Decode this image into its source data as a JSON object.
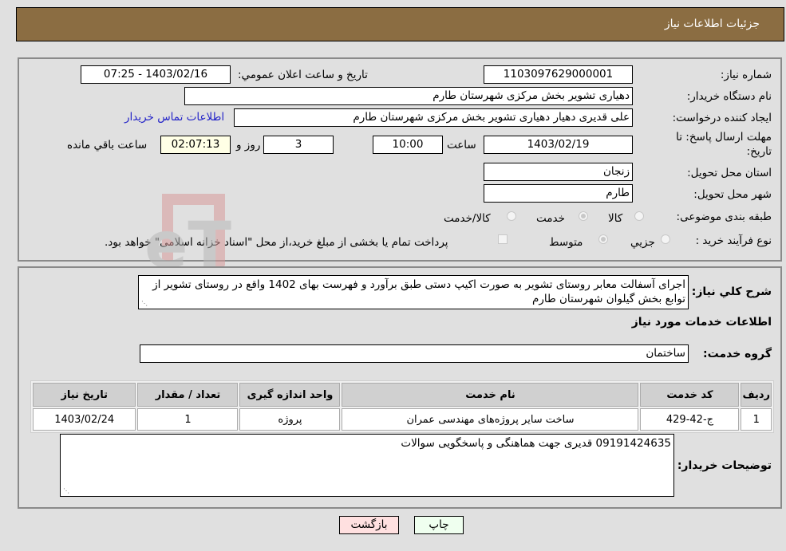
{
  "header": {
    "title": "جزئیات اطلاعات نیاز"
  },
  "form": {
    "need_number": {
      "label": "شماره نیاز:",
      "value": "1103097629000001"
    },
    "announce_datetime": {
      "label": "تاریخ و ساعت اعلان عمومي:",
      "value": "1403/02/16 - 07:25"
    },
    "buyer_org": {
      "label": "نام دستگاه خريدار:",
      "value": "دهیاری تشویر بخش مرکزی شهرستان طارم"
    },
    "requester": {
      "label": "ايجاد کننده درخواست:",
      "value": "علی قدیری دهیار دهیاری تشویر بخش مرکزی شهرستان طارم"
    },
    "buyer_contact_link": "اطلاعات تماس خريدار",
    "deadline": {
      "label_line1": "مهلت ارسال پاسخ: تا",
      "label_line2": "تاريخ:",
      "date": "1403/02/19",
      "time_label": "ساعت",
      "time": "10:00",
      "days": "3",
      "days_label": "روز و",
      "remaining": "02:07:13",
      "remaining_label": "ساعت باقي مانده"
    },
    "province": {
      "label": "استان محل تحویل:",
      "value": "زنجان"
    },
    "city": {
      "label": "شهر محل تحویل:",
      "value": "طارم"
    },
    "category": {
      "label": "طبقه بندی موضوعی:",
      "options": [
        "کالا",
        "خدمت",
        "کالا/خدمت"
      ],
      "selected": "خدمت"
    },
    "purchase_type": {
      "label": "نوع فرآیند خرید :",
      "options": [
        "جزيي",
        "متوسط"
      ],
      "selected": "متوسط",
      "treasury_note": "پرداخت تمام یا بخشی از مبلغ خرید،از محل \"اسناد خزانه اسلامی\" خواهد بود."
    }
  },
  "description": {
    "label": "شرح کلي نياز:",
    "value": "اجرای آسفالت معابر روستای تشویر به صورت اکیپ دستی طبق برآورد و فهرست بهای 1402 واقع در روستای تشویر از توابع بخش گیلوان شهرستان طارم"
  },
  "services_section": {
    "title": "اطلاعات خدمات مورد نياز",
    "group_label": "گروه خدمت:",
    "group_value": "ساختمان",
    "table": {
      "headers": [
        "رديف",
        "کد خدمت",
        "نام خدمت",
        "واحد اندازه گیری",
        "تعداد / مقدار",
        "تاريخ نياز"
      ],
      "rows": [
        [
          "1",
          "ج-42-429",
          "ساخت سایر پروژه‌های مهندسی عمران",
          "پروژه",
          "1",
          "1403/02/24"
        ]
      ]
    }
  },
  "buyer_notes": {
    "label": "توضيحات خريدار:",
    "value": "09191424635 قدیری جهت هماهنگی و پاسخگویی سوالات"
  },
  "buttons": {
    "print": "چاپ",
    "back": "بازگشت"
  },
  "watermark": {
    "text": "AriaTender.neT"
  }
}
